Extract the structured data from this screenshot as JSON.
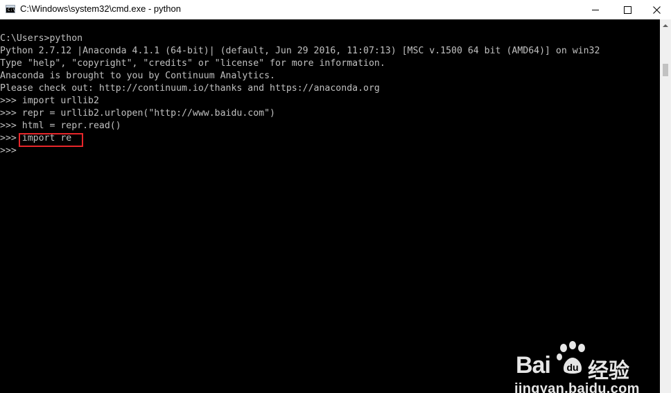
{
  "window": {
    "title": "C:\\Windows\\system32\\cmd.exe - python",
    "icon": "cmd-icon",
    "controls": [
      "minimize-icon",
      "maximize-icon",
      "close-icon"
    ]
  },
  "console": {
    "lines": [
      "C:\\Users>python",
      "Python 2.7.12 |Anaconda 4.1.1 (64-bit)| (default, Jun 29 2016, 11:07:13) [MSC v.1500 64 bit (AMD64)] on win32",
      "Type \"help\", \"copyright\", \"credits\" or \"license\" for more information.",
      "Anaconda is brought to you by Continuum Analytics.",
      "Please check out: http://continuum.io/thanks and https://anaconda.org",
      ">>> import urllib2",
      ">>> repr = urllib2.urlopen(\"http://www.baidu.com\")",
      ">>> html = repr.read()",
      ">>> import re",
      ">>>"
    ],
    "highlighted_text": "import re",
    "text_color": "#c0c0c0",
    "background_color": "#000000",
    "highlight_color": "#e8262a"
  },
  "watermark": {
    "brand_left": "Bai",
    "brand_right": "经验",
    "url": "jingyan.baidu.com"
  }
}
